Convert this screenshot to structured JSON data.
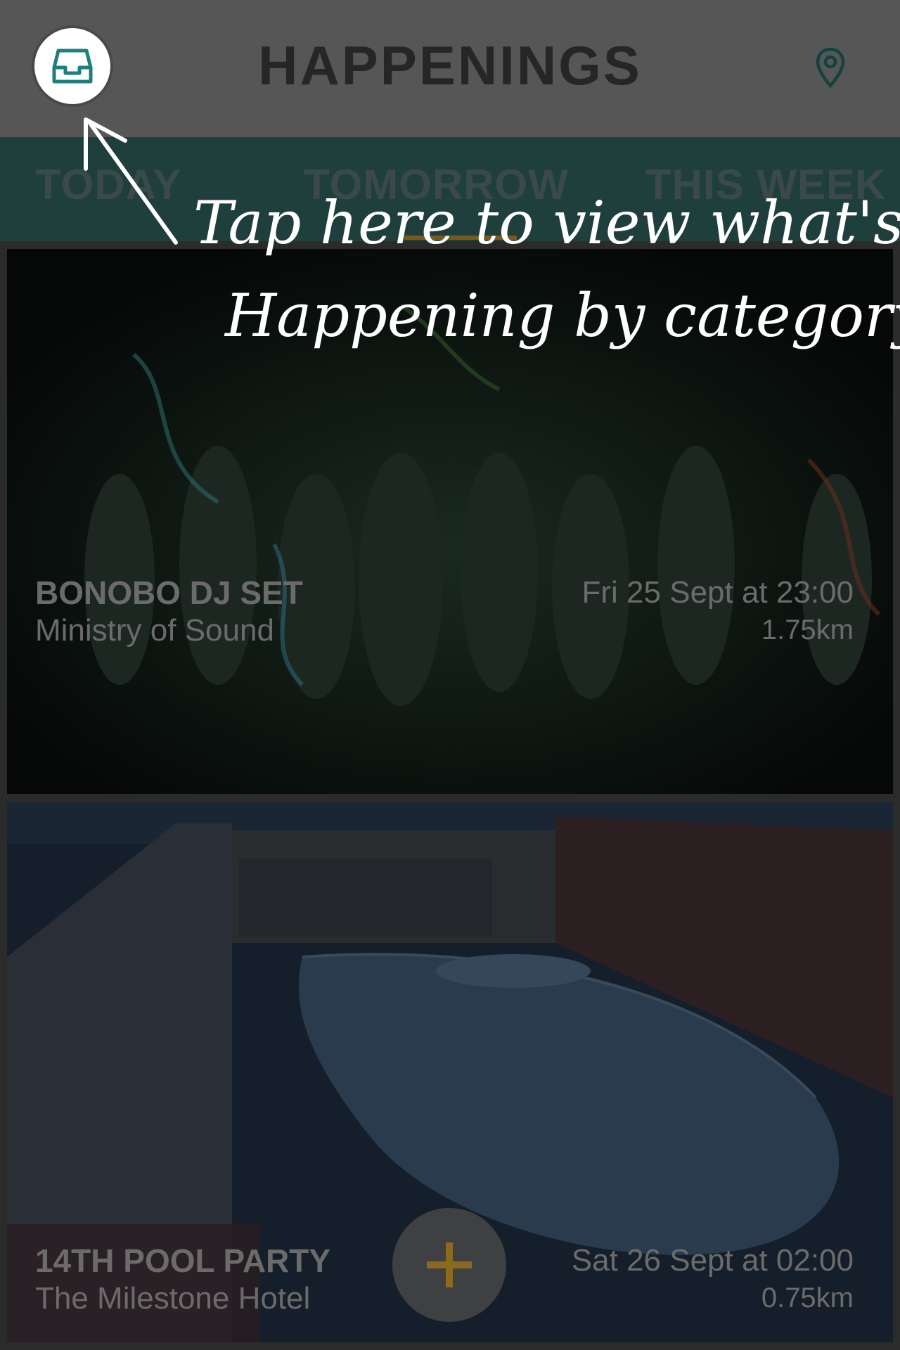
{
  "header": {
    "title": "HAPPENINGS",
    "left_icon": "inbox-icon",
    "right_icon": "location-pin-icon"
  },
  "tabs": [
    {
      "label": "TODAY"
    },
    {
      "label": "TOMORROW"
    },
    {
      "label": "THIS WEEK"
    }
  ],
  "events": [
    {
      "title": "BONOBO DJ SET",
      "venue": "Ministry of Sound",
      "datetime": "Fri 25 Sept at 23:00",
      "distance": "1.75km"
    },
    {
      "title": "14TH POOL PARTY",
      "venue": "The Milestone Hotel",
      "datetime": "Sat 26 Sept at 02:00",
      "distance": "0.75km"
    }
  ],
  "add_button": {
    "icon": "plus-icon"
  },
  "annotation": {
    "line1": "Tap here to view what's",
    "line2": "Happening by category"
  },
  "colors": {
    "accent": "#1e7f7c",
    "fab_plus": "#8a6a1e"
  }
}
